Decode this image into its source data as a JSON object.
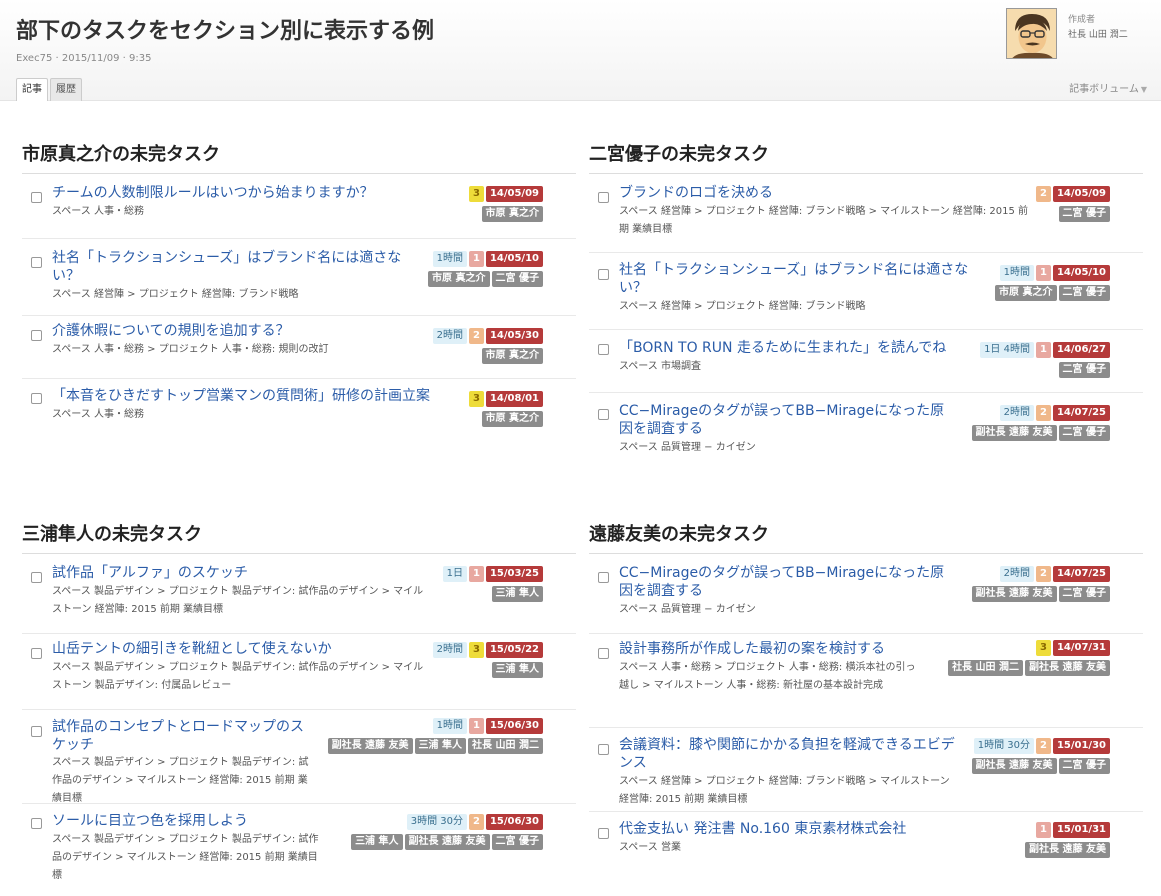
{
  "page": {
    "title": "部下のタスクをセクション別に表示する例",
    "meta": "Exec75 · 2015/11/09 · 9:35",
    "tabs": [
      "記事",
      "履歴"
    ],
    "author_label": "作成者",
    "author_name": "社長 山田 潤二",
    "volume_label": "記事ボリューム",
    "volume_caret": "▼"
  },
  "sections": [
    {
      "title": "市原真之介の未完タスク",
      "tasks": [
        {
          "title": "チームの人数制限ルールはいつから始まりますか？",
          "path": "スペース 人事・総務",
          "estimate": "",
          "priority": "3",
          "due": "14/05/09",
          "people": [
            "市原 真之介"
          ]
        },
        {
          "title": "社名「トラクションシューズ」はブランド名には適さない？",
          "path": "スペース 経営陣 > プロジェクト 経営陣: ブランド戦略",
          "estimate": "1時間",
          "priority": "1",
          "due": "14/05/10",
          "people": [
            "市原 真之介",
            "二宮 優子"
          ]
        },
        {
          "title": "介護休暇についての規則を追加する？",
          "path": "スペース 人事・総務 > プロジェクト 人事・総務: 規則の改訂",
          "estimate": "2時間",
          "priority": "2",
          "due": "14/05/30",
          "people": [
            "市原 真之介"
          ]
        },
        {
          "title": "「本音をひきだすトップ営業マンの質問術」研修の計画立案",
          "path": "スペース 人事・総務",
          "estimate": "",
          "priority": "3",
          "due": "14/08/01",
          "people": [
            "市原 真之介"
          ]
        }
      ]
    },
    {
      "title": "二宮優子の未完タスク",
      "tasks": [
        {
          "title": "ブランドのロゴを決める",
          "path": "スペース 経営陣 > プロジェクト 経営陣: ブランド戦略 > マイルストーン 経営陣: 2015 前期 業績目標",
          "estimate": "",
          "priority": "2",
          "due": "14/05/09",
          "people": [
            "二宮 優子"
          ]
        },
        {
          "title": "社名「トラクションシューズ」はブランド名には適さない？",
          "path": "スペース 経営陣 > プロジェクト 経営陣: ブランド戦略",
          "estimate": "1時間",
          "priority": "1",
          "due": "14/05/10",
          "people": [
            "市原 真之介",
            "二宮 優子"
          ]
        },
        {
          "title": "「BORN TO RUN 走るために生まれた」を読んでね",
          "path": "スペース 市場調査",
          "estimate": "1日 4時間",
          "priority": "1",
          "due": "14/06/27",
          "people": [
            "二宮 優子"
          ]
        },
        {
          "title": "CC−Mirageのタグが誤ってBB−Mirageになった原因を調査する",
          "path": "スペース 品質管理 − カイゼン",
          "estimate": "2時間",
          "priority": "2",
          "due": "14/07/25",
          "people": [
            "副社長 遠藤 友美",
            "二宮 優子"
          ]
        }
      ]
    },
    {
      "title": "三浦隼人の未完タスク",
      "tasks": [
        {
          "title": "試作品「アルファ」のスケッチ",
          "path": "スペース 製品デザイン > プロジェクト 製品デザイン: 試作品のデザイン > マイルストーン 経営陣: 2015 前期 業績目標",
          "estimate": "1日",
          "priority": "1",
          "due": "15/03/25",
          "people": [
            "三浦 隼人"
          ]
        },
        {
          "title": "山岳テントの細引きを靴紐として使えないか",
          "path": "スペース 製品デザイン > プロジェクト 製品デザイン: 試作品のデザイン > マイルストーン 製品デザイン: 付属品レビュー",
          "estimate": "2時間",
          "priority": "3",
          "due": "15/05/22",
          "people": [
            "三浦 隼人"
          ]
        },
        {
          "title": "試作品のコンセプトとロードマップのスケッチ",
          "path": "スペース 製品デザイン > プロジェクト 製品デザイン: 試作品のデザイン > マイルストーン 経営陣: 2015 前期 業績目標",
          "estimate": "1時間",
          "priority": "1",
          "due": "15/06/30",
          "people": [
            "副社長 遠藤 友美",
            "三浦 隼人",
            "社長 山田 潤二"
          ]
        },
        {
          "title": "ソールに目立つ色を採用しよう",
          "path": "スペース 製品デザイン > プロジェクト 製品デザイン: 試作品のデザイン > マイルストーン 経営陣: 2015 前期 業績目標",
          "estimate": "3時間 30分",
          "priority": "2",
          "due": "15/06/30",
          "people": [
            "三浦 隼人",
            "副社長 遠藤 友美",
            "二宮 優子"
          ]
        }
      ]
    },
    {
      "title": "遠藤友美の未完タスク",
      "tasks": [
        {
          "title": "CC−Mirageのタグが誤ってBB−Mirageになった原因を調査する",
          "path": "スペース 品質管理 − カイゼン",
          "estimate": "2時間",
          "priority": "2",
          "due": "14/07/25",
          "people": [
            "副社長 遠藤 友美",
            "二宮 優子"
          ]
        },
        {
          "title": "設計事務所が作成した最初の案を検討する",
          "path": "スペース 人事・総務 > プロジェクト 人事・総務: 横浜本社の引っ越し > マイルストーン 人事・総務: 新社屋の基本設計完成",
          "estimate": "",
          "priority": "3",
          "due": "14/07/31",
          "people": [
            "社長 山田 潤二",
            "副社長 遠藤 友美"
          ]
        },
        {
          "title": "会議資料：膝や関節にかかる負担を軽減できるエビデンス",
          "path": "スペース 経営陣 > プロジェクト 経営陣: ブランド戦略 > マイルストーン 経営陣: 2015 前期 業績目標",
          "estimate": "1時間 30分",
          "priority": "2",
          "due": "15/01/30",
          "people": [
            "副社長 遠藤 友美",
            "二宮 優子"
          ]
        },
        {
          "title": "代金支払い 発注書 No.160 東京素材株式会社",
          "path": "スペース 営業",
          "estimate": "",
          "priority": "1",
          "due": "15/01/31",
          "people": [
            "副社長 遠藤 友美"
          ]
        }
      ]
    }
  ]
}
